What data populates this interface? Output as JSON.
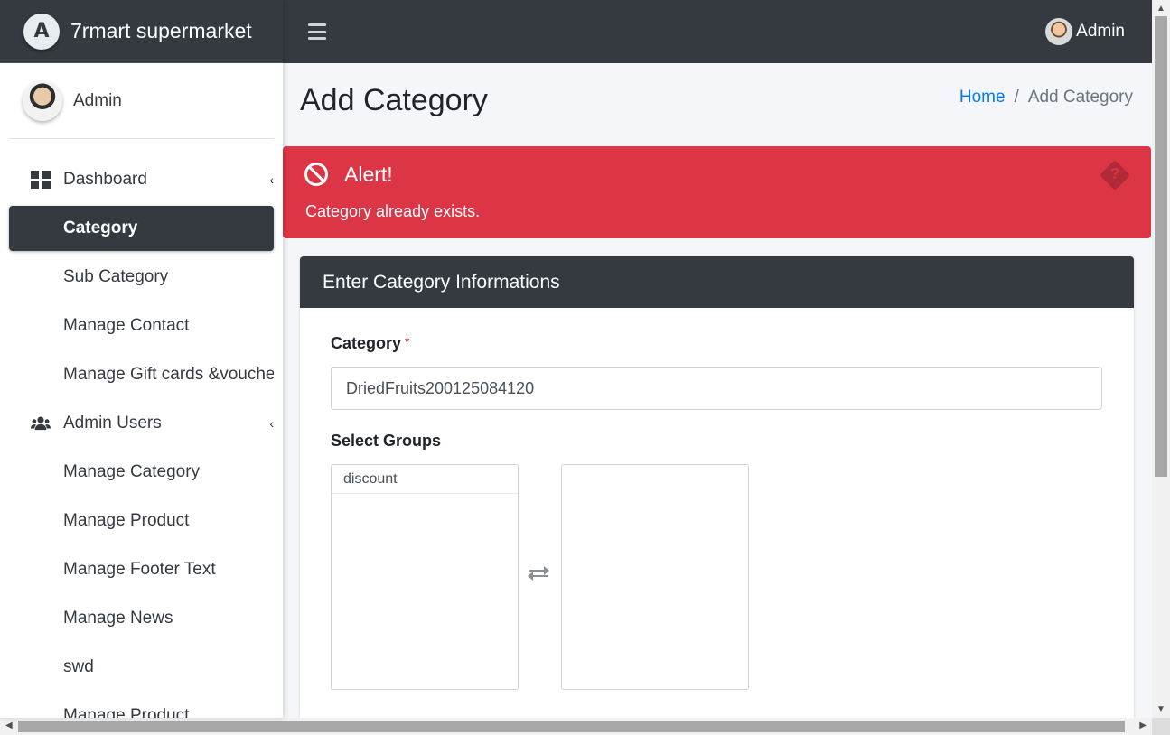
{
  "brand": {
    "name": "7rmart supermarket",
    "logo_letter": "A"
  },
  "sidebar": {
    "user_name": "Admin",
    "items": [
      {
        "label": "Dashboard",
        "icon": "dashboard-icon",
        "has_caret": true
      },
      {
        "label": "Category",
        "icon": "",
        "active": true
      },
      {
        "label": "Sub Category",
        "icon": ""
      },
      {
        "label": "Manage Contact",
        "icon": ""
      },
      {
        "label": "Manage Gift cards &vouchers",
        "icon": ""
      },
      {
        "label": "Admin Users",
        "icon": "users-icon",
        "has_caret": true
      },
      {
        "label": "Manage Category",
        "icon": ""
      },
      {
        "label": "Manage Product",
        "icon": ""
      },
      {
        "label": "Manage Footer Text",
        "icon": ""
      },
      {
        "label": "Manage News",
        "icon": ""
      },
      {
        "label": "swd",
        "icon": ""
      },
      {
        "label": "Manage Product",
        "icon": ""
      }
    ]
  },
  "topbar": {
    "user_name": "Admin"
  },
  "header": {
    "title": "Add Category",
    "breadcrumb": {
      "home": "Home",
      "current": "Add Category"
    }
  },
  "alert": {
    "title": "Alert!",
    "message": "Category already exists.",
    "color": "#dc3545"
  },
  "form": {
    "card_title": "Enter Category Informations",
    "category_label": "Category",
    "required_mark": "*",
    "category_value": "DriedFruits200125084120",
    "groups_label": "Select Groups",
    "available_groups": [
      "discount"
    ],
    "selected_groups": []
  },
  "colors": {
    "dark": "#343a40",
    "primary_link": "#007bff",
    "danger": "#dc3545"
  }
}
